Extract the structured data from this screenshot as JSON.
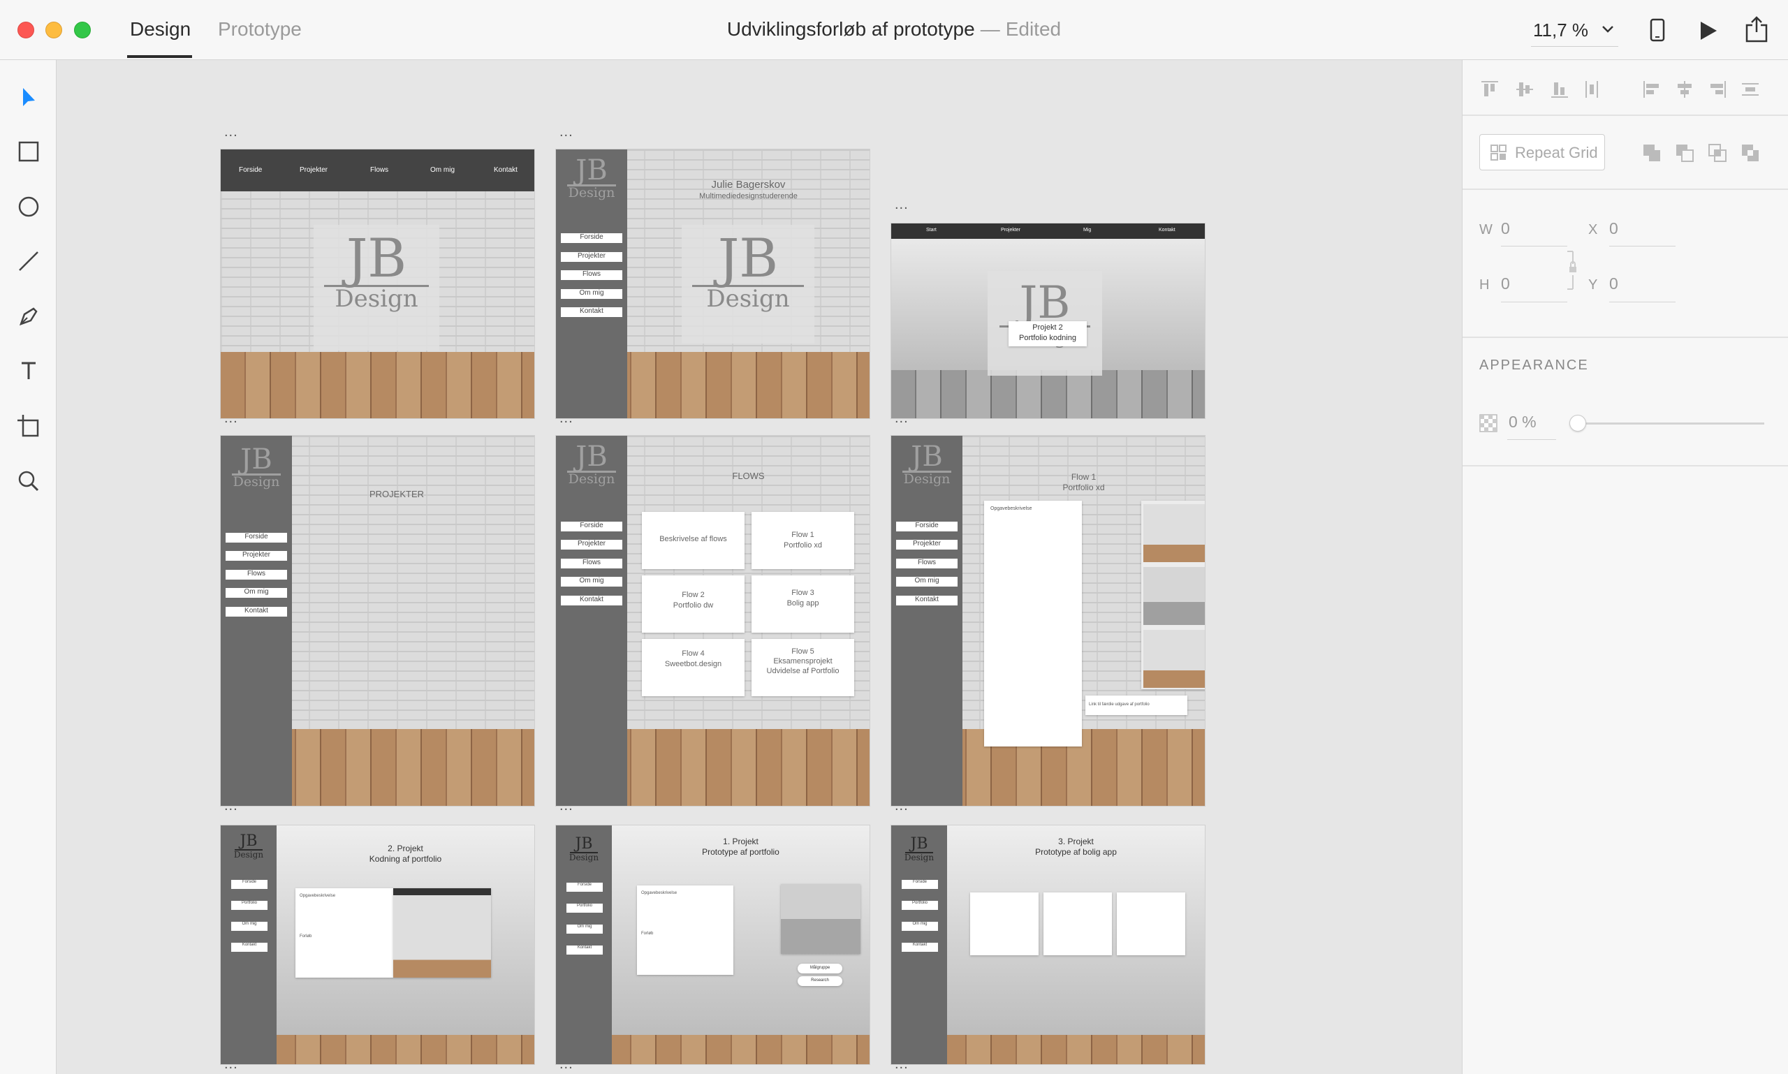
{
  "window": {
    "tabs": [
      {
        "label": "Design"
      },
      {
        "label": "Prototype"
      }
    ],
    "title": "Udviklingsforløb af prototype",
    "title_separator": "—",
    "status": "Edited",
    "zoom": "11,7 %"
  },
  "toolbar": {
    "tools": [
      "select-tool",
      "rectangle-tool",
      "ellipse-tool",
      "line-tool",
      "pen-tool",
      "text-tool",
      "artboard-tool",
      "zoom-tool"
    ]
  },
  "artboards": {
    "top_nav": [
      "Forside",
      "Projekter",
      "Flows",
      "Om mig",
      "Kontakt"
    ],
    "side_nav": [
      "Forside",
      "Projekter",
      "Flows",
      "Om mig",
      "Kontakt"
    ],
    "logo": {
      "initials": "JB",
      "word": "Design"
    },
    "ab2": {
      "name": "Julie Bagerskov",
      "subtitle": "Multimediedesignstuderende"
    },
    "ab3": {
      "nav": [
        "Start",
        "Projekter",
        "Mig",
        "Kontakt"
      ],
      "card_line1": "Projekt 2",
      "card_line2": "Portfolio kodning"
    },
    "ab4": {
      "heading": "PROJEKTER"
    },
    "ab5": {
      "heading": "FLOWS",
      "cards": [
        {
          "l1": "Beskrivelse af flows",
          "l2": "",
          "l3": ""
        },
        {
          "l1": "Flow 1",
          "l2": "Portfolio xd",
          "l3": ""
        },
        {
          "l1": "Flow 2",
          "l2": "Portfolio dw",
          "l3": ""
        },
        {
          "l1": "Flow 3",
          "l2": "Bolig app",
          "l3": ""
        },
        {
          "l1": "Flow 4",
          "l2": "Sweetbot.design",
          "l3": ""
        },
        {
          "l1": "Flow 5",
          "l2": "Eksamensprojekt",
          "l3": "Udvidelse af Portfolio"
        }
      ]
    },
    "ab6": {
      "heading1": "Flow 1",
      "heading2": "Portfolio xd",
      "text_label": "Opgavebeskrivelse",
      "link_text": "Link til færdie udgave af portfolio"
    },
    "ab7": {
      "heading1": "2. Projekt",
      "heading2": "Kodning af portfolio",
      "label1": "Opgavebeskrivelse",
      "label2": "Forløb",
      "side_nav": [
        "Forside",
        "Portfolio",
        "Om mig",
        "Kontakt"
      ]
    },
    "ab8": {
      "heading1": "1. Projekt",
      "heading2": "Prototype af portfolio",
      "label1": "Opgavebeskrivelse",
      "label2": "Forløb",
      "btn1": "Målgruppe",
      "btn2": "Research",
      "side_nav": [
        "Forside",
        "Portfolio",
        "Om mig",
        "Kontakt"
      ]
    },
    "ab9": {
      "heading1": "3. Projekt",
      "heading2": "Prototype af bolig app",
      "side_nav": [
        "Forside",
        "Portfolio",
        "Om mig",
        "Kontakt"
      ]
    },
    "more_indicator": "..."
  },
  "inspector": {
    "repeat_grid": "Repeat Grid",
    "w_label": "W",
    "w_value": "0",
    "h_label": "H",
    "h_value": "0",
    "x_label": "X",
    "x_value": "0",
    "y_label": "Y",
    "y_value": "0",
    "appearance_label": "APPEARANCE",
    "opacity": "0 %"
  },
  "colors": {
    "accent": "#1a8cff",
    "sidebar": "#6b6b6b",
    "topnav": "#444444"
  }
}
